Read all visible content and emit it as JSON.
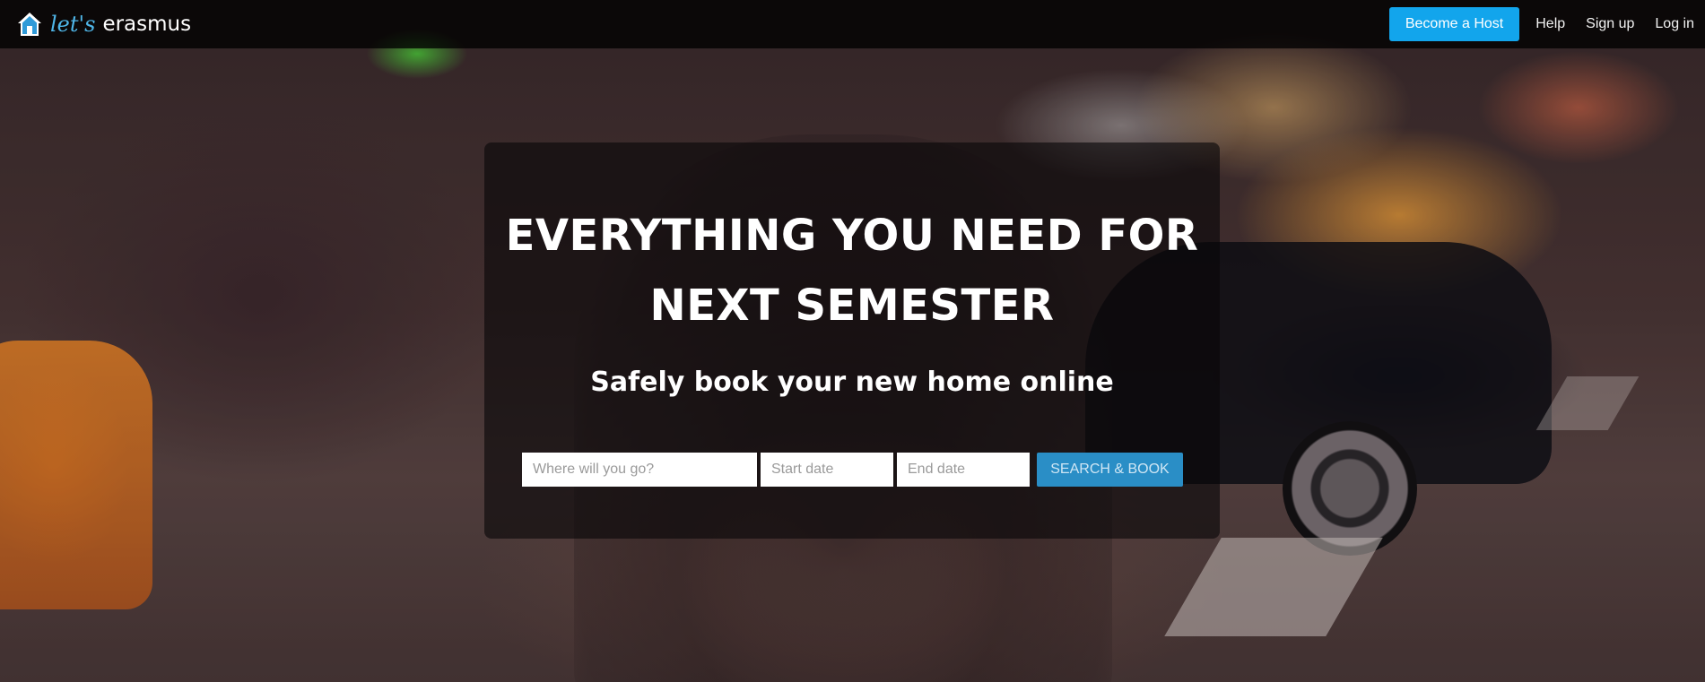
{
  "brand": {
    "icon": "house-icon",
    "lets": "let's",
    "name": "erasmus",
    "accent_color": "#4fb6e8"
  },
  "nav": {
    "become_host": "Become a Host",
    "help": "Help",
    "sign_up": "Sign up",
    "log_in": "Log in",
    "button_color": "#12a5ec"
  },
  "hero": {
    "title_line1": "EVERYTHING YOU NEED FOR",
    "title_line2": "NEXT SEMESTER",
    "subtitle": "Safely book your new home online"
  },
  "search": {
    "where_placeholder": "Where will you go?",
    "start_placeholder": "Start date",
    "end_placeholder": "End date",
    "button_label": "SEARCH & BOOK",
    "button_color": "#2a8ec6"
  }
}
